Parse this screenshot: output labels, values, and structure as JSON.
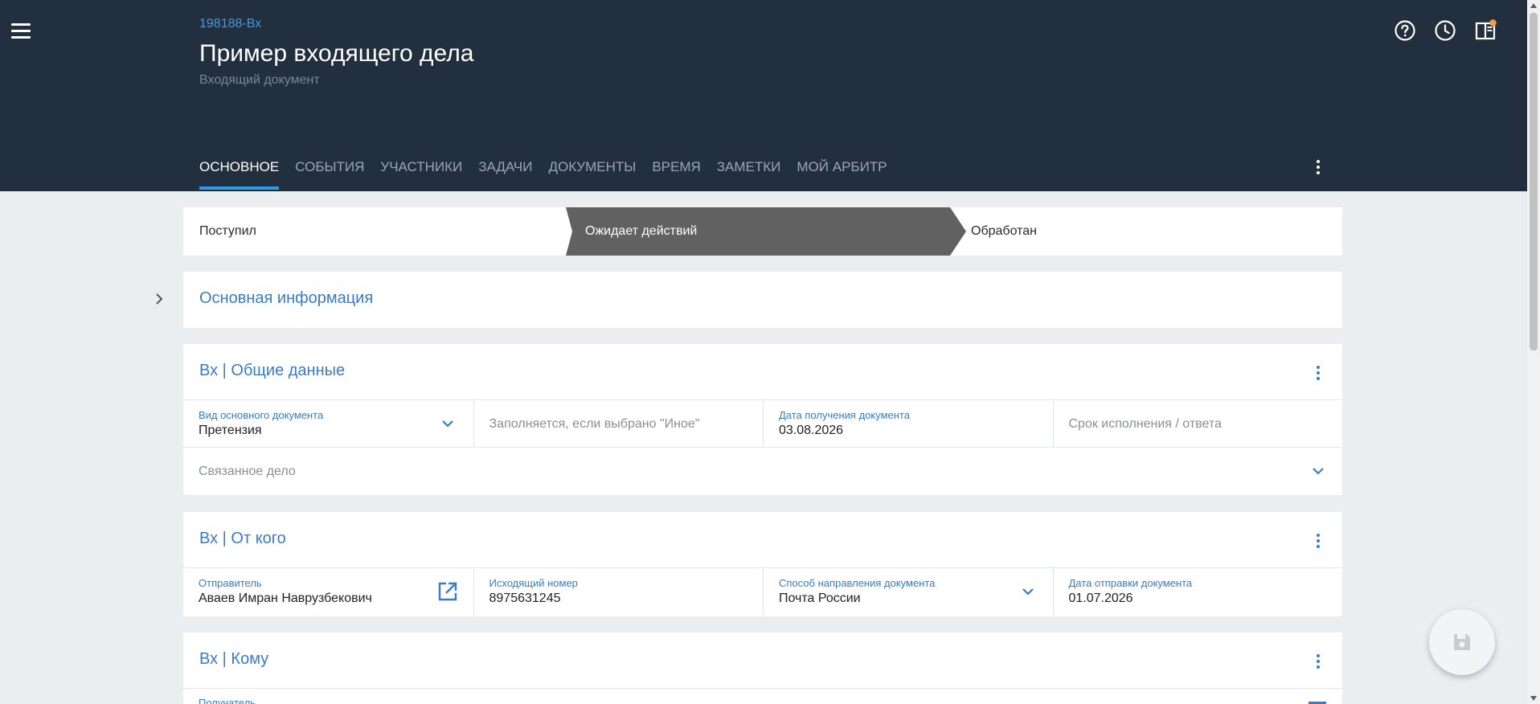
{
  "header": {
    "case_id": "198188-Вх",
    "title": "Пример входящего дела",
    "subtitle": "Входящий документ",
    "icons": [
      "menu-icon",
      "help-icon",
      "clock-icon",
      "panel-icon"
    ],
    "notification_dot_color": "#f0a04b",
    "background": "#222f3e"
  },
  "tabs": [
    {
      "label": "Основное",
      "active": true
    },
    {
      "label": "События",
      "active": false
    },
    {
      "label": "Участники",
      "active": false
    },
    {
      "label": "Задачи",
      "active": false
    },
    {
      "label": "Документы",
      "active": false
    },
    {
      "label": "Время",
      "active": false
    },
    {
      "label": "Заметки",
      "active": false
    },
    {
      "label": "Мой Арбитр",
      "active": false
    }
  ],
  "stepper": {
    "steps": [
      "Поступил",
      "Ожидает действий",
      "Обработан"
    ],
    "active_index": 1
  },
  "main_info": {
    "title": "Основная информация"
  },
  "general": {
    "title": "Вх | Общие данные",
    "doc_type": {
      "label": "Вид основного документа",
      "value": "Претензия"
    },
    "other_placeholder": "Заполняется, если выбрано \"Иное\"",
    "received_date": {
      "label": "Дата получения документа",
      "value": "03.08.2026"
    },
    "deadline_placeholder": "Срок исполнения / ответа",
    "related_case_placeholder": "Связанное дело"
  },
  "from": {
    "title": "Вх | От кого",
    "sender": {
      "label": "Отправитель",
      "value": "Аваев Имран Наврузбекович"
    },
    "outgoing_number": {
      "label": "Исходящий номер",
      "value": "8975631245"
    },
    "delivery_method": {
      "label": "Способ направления документа",
      "value": "Почта России"
    },
    "sent_date": {
      "label": "Дата отправки документа",
      "value": "01.07.2026"
    }
  },
  "to": {
    "title": "Вх | Кому",
    "recipient_label": "Получатель"
  },
  "fab": {
    "icon": "save-icon"
  },
  "colors": {
    "accent": "#2b9be8",
    "link_blue": "#3a7bc8",
    "active_step": "#616161"
  }
}
